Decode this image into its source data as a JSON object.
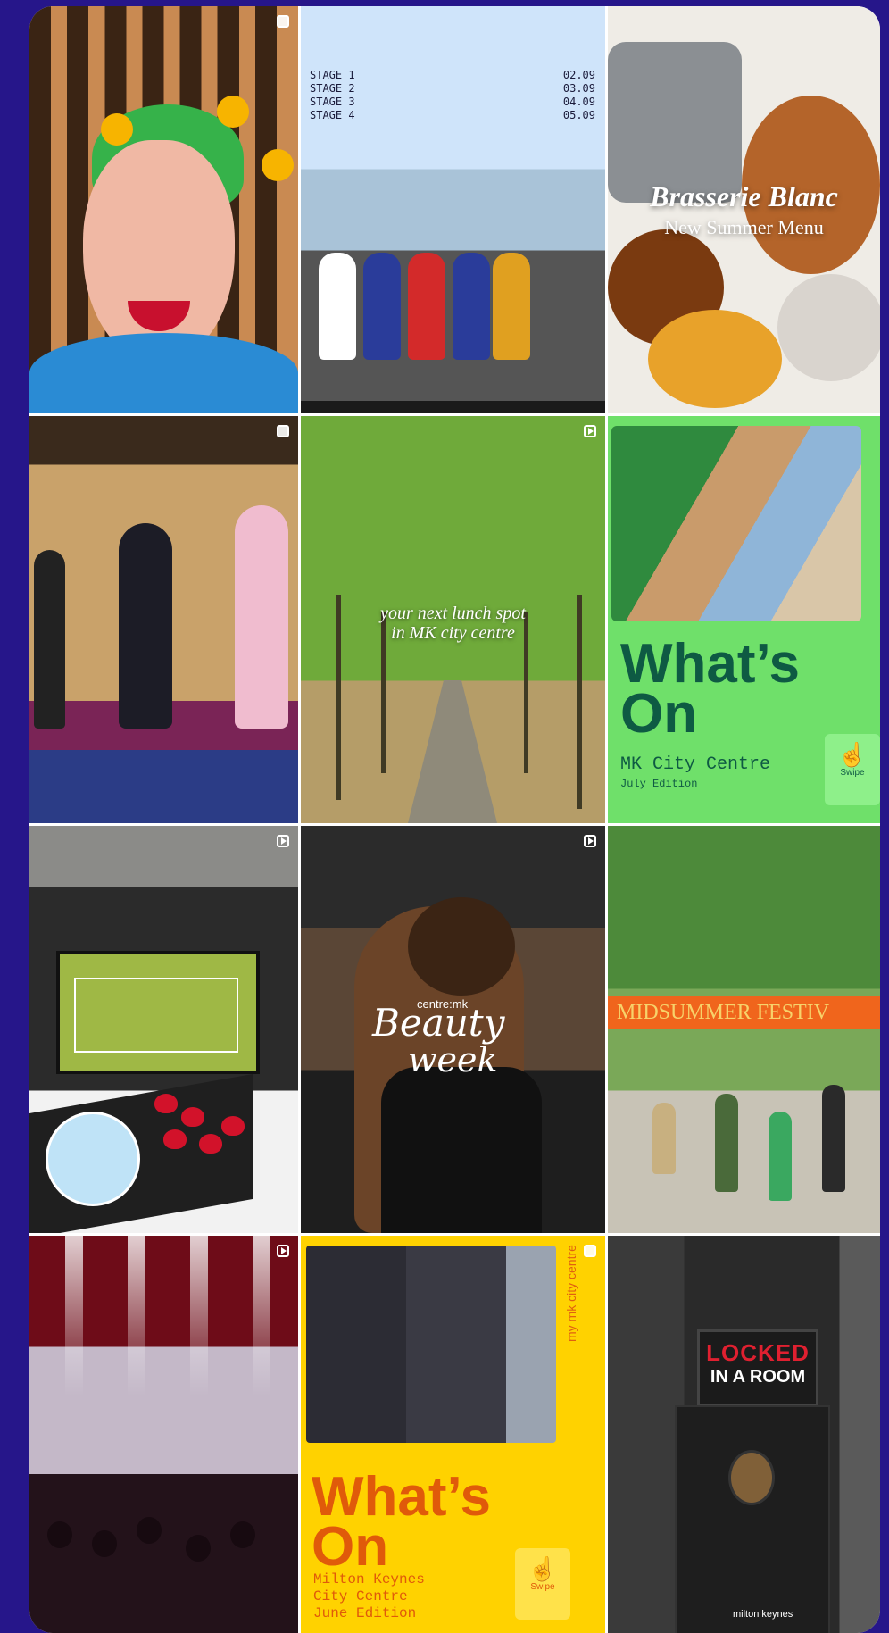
{
  "tiles": {
    "t2": {
      "stages": [
        {
          "label": "STAGE 1",
          "time": "02.09"
        },
        {
          "label": "STAGE 2",
          "time": "03.09"
        },
        {
          "label": "STAGE 3",
          "time": "04.09"
        },
        {
          "label": "STAGE 4",
          "time": "05.09"
        }
      ]
    },
    "t3": {
      "title": "Brasserie Blanc",
      "subtitle": "New Summer Menu"
    },
    "t5": {
      "caption_line1": "your next lunch spot",
      "caption_line2": "in MK city centre"
    },
    "t6": {
      "heading_line1": "What’s",
      "heading_line2": "On",
      "place": "MK City Centre",
      "edition": "July Edition",
      "swipe": "Swipe"
    },
    "t8": {
      "brand": "centre:mk",
      "script_line1": "Beauty",
      "script_line2": "week"
    },
    "t9": {
      "banner": "MIDSUMMER FESTIV"
    },
    "t11": {
      "vertical": "my mk city centre",
      "heading_line1": "What’s",
      "heading_line2": "On",
      "place_line1": "Milton Keynes",
      "place_line2": "City Centre",
      "edition": "June Edition",
      "swipe": "Swipe"
    },
    "t12": {
      "sign_line1": "LOCKED",
      "sign_line2": "IN A ROOM",
      "footer": "milton keynes"
    }
  },
  "colors": {
    "background": "#26168a",
    "whats_on_green": "#6fe06a",
    "whats_on_yellow": "#ffd200"
  }
}
